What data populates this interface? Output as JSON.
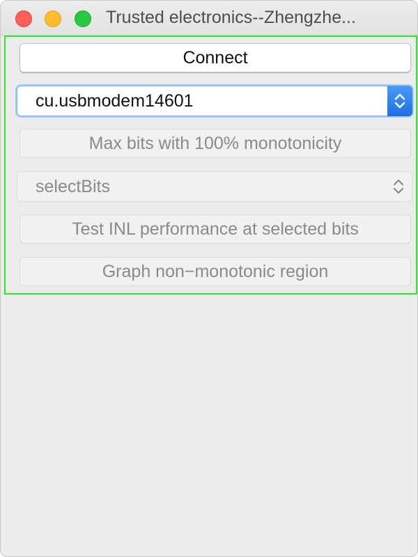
{
  "window": {
    "title": "Trusted electronics--Zhengzhe..."
  },
  "panel": {
    "connect_button": "Connect",
    "port_select": {
      "selected": "cu.usbmodem14601"
    },
    "max_bits_button": "Max bits with 100% monotonicity",
    "bits_select": {
      "selected": "selectBits"
    },
    "test_inl_button": "Test INL performance at selected bits",
    "graph_button": "Graph non−monotonic region"
  },
  "colors": {
    "highlight_border": "#2bea2b",
    "accent_blue": "#1f6fe0",
    "close": "#fe5f57",
    "minimize": "#febc2e",
    "zoom": "#28c840"
  }
}
